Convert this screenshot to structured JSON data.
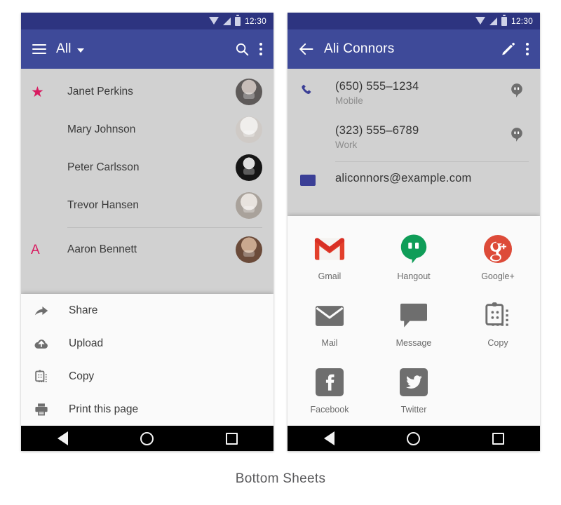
{
  "caption": "Bottom Sheets",
  "theme": {
    "appbar_color": "#3e4a99",
    "statusbar_color": "#2d3480",
    "accent_pink": "#d81b60",
    "scrim_color": "#d1d1d1",
    "sheet_color": "#fafafa",
    "navbar_color": "#000000"
  },
  "left_phone": {
    "statusbar": {
      "time": "12:30",
      "icons": [
        "wifi-icon",
        "signal-icon",
        "battery-icon"
      ]
    },
    "appbar": {
      "menu_icon": "hamburger-icon",
      "title": "All",
      "dropdown_icon": "chevron-down-icon",
      "search_icon": "search-icon",
      "overflow_icon": "overflow-menu-icon"
    },
    "contacts": [
      {
        "mark": "★",
        "mark_type": "star",
        "name": "Janet Perkins"
      },
      {
        "mark": "",
        "mark_type": "none",
        "name": "Mary Johnson"
      },
      {
        "mark": "",
        "mark_type": "none",
        "name": "Peter Carlsson"
      },
      {
        "mark": "",
        "mark_type": "none",
        "name": "Trevor Hansen"
      },
      {
        "mark": "A",
        "mark_type": "letter",
        "name": "Aaron Bennett"
      }
    ],
    "sheet": {
      "type": "list",
      "items": [
        {
          "icon": "share-icon",
          "label": "Share"
        },
        {
          "icon": "upload-icon",
          "label": "Upload"
        },
        {
          "icon": "copy-icon",
          "label": "Copy"
        },
        {
          "icon": "print-icon",
          "label": "Print this page"
        }
      ]
    },
    "navbar": {
      "back": "back-icon",
      "home": "home-icon",
      "recents": "recents-icon"
    }
  },
  "right_phone": {
    "statusbar": {
      "time": "12:30",
      "icons": [
        "wifi-icon",
        "signal-icon",
        "battery-icon"
      ]
    },
    "appbar": {
      "back_icon": "back-arrow-icon",
      "title": "Ali Connors",
      "edit_icon": "pencil-icon",
      "overflow_icon": "overflow-menu-icon"
    },
    "details": [
      {
        "icon": "phone-icon",
        "primary": "(650) 555–1234",
        "secondary": "Mobile",
        "trailing": "hangouts-bubble-icon"
      },
      {
        "icon": "",
        "primary": "(323) 555–6789",
        "secondary": "Work",
        "trailing": "hangouts-bubble-icon"
      },
      {
        "icon": "email-icon",
        "primary": "aliconnors@example.com",
        "secondary": "",
        "trailing": ""
      }
    ],
    "sheet": {
      "type": "grid",
      "items": [
        {
          "icon": "gmail-icon",
          "label": "Gmail"
        },
        {
          "icon": "hangouts-icon",
          "label": "Hangout"
        },
        {
          "icon": "googleplus-icon",
          "label": "Google+"
        },
        {
          "icon": "mail-icon",
          "label": "Mail"
        },
        {
          "icon": "message-icon",
          "label": "Message"
        },
        {
          "icon": "copy-icon",
          "label": "Copy"
        },
        {
          "icon": "facebook-icon",
          "label": "Facebook"
        },
        {
          "icon": "twitter-icon",
          "label": "Twitter"
        }
      ]
    },
    "navbar": {
      "back": "back-icon",
      "home": "home-icon",
      "recents": "recents-icon"
    }
  }
}
